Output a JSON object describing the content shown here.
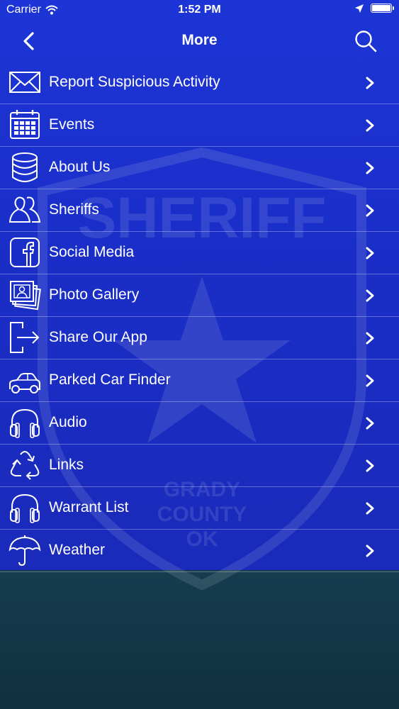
{
  "status_bar": {
    "carrier": "Carrier",
    "time": "1:52 PM"
  },
  "nav": {
    "title": "More"
  },
  "watermark": {
    "line1": "SHERIFF",
    "line2": "GRADY",
    "line3": "COUNTY",
    "line4": "OK"
  },
  "menu": {
    "items": [
      {
        "label": "Report Suspicious Activity",
        "icon": "envelope-icon"
      },
      {
        "label": "Events",
        "icon": "calendar-icon"
      },
      {
        "label": "About Us",
        "icon": "database-icon"
      },
      {
        "label": "Sheriffs",
        "icon": "users-icon"
      },
      {
        "label": "Social Media",
        "icon": "facebook-icon"
      },
      {
        "label": "Photo Gallery",
        "icon": "photo-gallery-icon"
      },
      {
        "label": "Share Our App",
        "icon": "share-exit-icon"
      },
      {
        "label": "Parked Car Finder",
        "icon": "car-icon"
      },
      {
        "label": "Audio",
        "icon": "headphones-icon"
      },
      {
        "label": "Links",
        "icon": "recycle-icon"
      },
      {
        "label": "Warrant List",
        "icon": "headphones-icon"
      },
      {
        "label": "Weather",
        "icon": "umbrella-icon"
      }
    ]
  },
  "colors": {
    "header_blue": "#1d35d6",
    "list_blue": "#1a2ec7",
    "bottom_teal": "#163c4f",
    "divider": "#6a7be0"
  }
}
